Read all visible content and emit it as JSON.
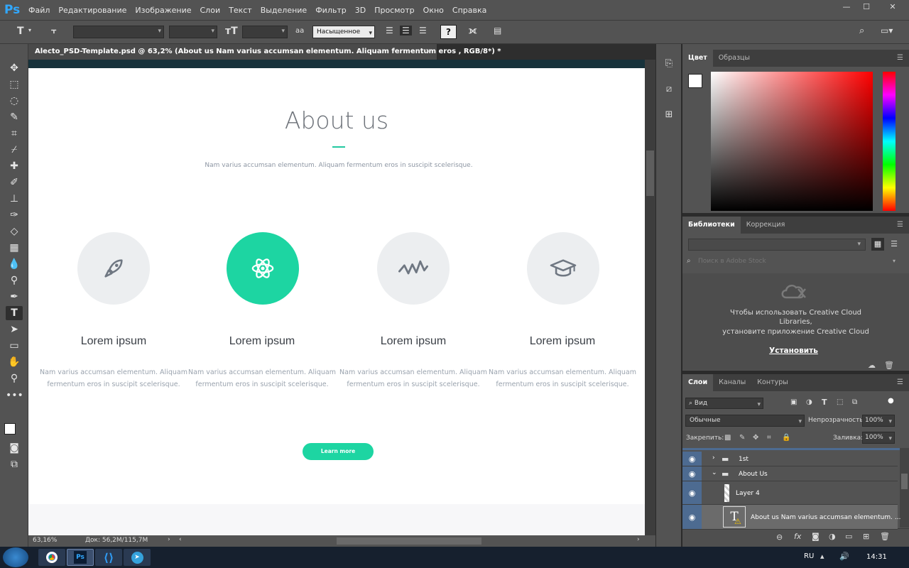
{
  "app": {
    "logo": "Ps",
    "menu": [
      "Файл",
      "Редактирование",
      "Изображение",
      "Слои",
      "Текст",
      "Выделение",
      "Фильтр",
      "3D",
      "Просмотр",
      "Окно",
      "Справка"
    ]
  },
  "options_bar": {
    "tool_icon": "T",
    "antialias_icon": "aa",
    "antialias_value": "Насыщенное",
    "help_glyph": "?"
  },
  "document": {
    "tab_title": "Alecto_PSD-Template.psd @ 63,2% (About us Nam varius accumsan elementum. Aliquam fermentum eros , RGB/8*) *",
    "tab_close": "×",
    "zoom": "63,16%",
    "doc_size": "Док: 56,2M/115,7M"
  },
  "page": {
    "heading": "About us",
    "subtitle": "Nam varius accumsan elementum. Aliquam fermentum eros in suscipit scelerisque.",
    "features": [
      {
        "icon": "rocket-icon",
        "title": "Lorem ipsum",
        "text": "Nam varius accumsan elementum. Aliquam fermentum eros in suscipit scelerisque.",
        "highlighted": false
      },
      {
        "icon": "atom-icon",
        "title": "Lorem ipsum",
        "text": "Nam varius accumsan elementum. Aliquam fermentum eros in suscipit scelerisque.",
        "highlighted": true
      },
      {
        "icon": "pulse-icon",
        "title": "Lorem ipsum",
        "text": "Nam varius accumsan elementum. Aliquam fermentum eros in suscipit scelerisque.",
        "highlighted": false
      },
      {
        "icon": "graduation-cap-icon",
        "title": "Lorem ipsum",
        "text": "Nam varius accumsan elementum. Aliquam fermentum eros in suscipit scelerisque.",
        "highlighted": false
      }
    ],
    "button": "Learn more",
    "accent": "#1dd5a2"
  },
  "color_panel": {
    "tabs": [
      "Цвет",
      "Образцы"
    ]
  },
  "libraries_panel": {
    "tabs": [
      "Библиотеки",
      "Коррекция"
    ],
    "search_placeholder": "Поиск в Adobe Stock",
    "message_line1": "Чтобы использовать Creative Cloud",
    "message_line2": "Libraries,",
    "message_line3": "установите приложение Creative Cloud",
    "install": "Установить"
  },
  "layers_panel": {
    "tabs": [
      "Слои",
      "Каналы",
      "Контуры"
    ],
    "filter": "Вид",
    "blend_mode": "Обычные",
    "opacity_label": "Непрозрачность:",
    "opacity_value": "100%",
    "lock_label": "Закрепить:",
    "fill_label": "Заливка:",
    "fill_value": "100%",
    "layers": [
      {
        "name": "1st",
        "type": "group",
        "expanded": false
      },
      {
        "name": "About Us",
        "type": "group",
        "expanded": true
      },
      {
        "name": "Layer 4",
        "type": "pixel"
      },
      {
        "name": "About us Nam varius accumsan elementum. ...",
        "type": "text",
        "selected": true
      }
    ]
  },
  "taskbar": {
    "lang": "RU",
    "time": "14:31"
  }
}
